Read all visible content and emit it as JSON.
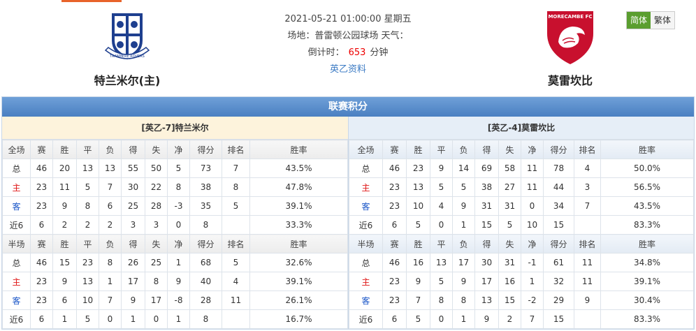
{
  "match": {
    "datetime": "2021-05-21 01:00:00 星期五",
    "venue_line": "场地：普雷顿公园球场 天气：",
    "countdown_label": "倒计时：",
    "countdown_value": "653",
    "countdown_unit": "分钟",
    "league_link": "英乙资料"
  },
  "home_team": {
    "name": "特兰米尔(主)",
    "logo_text": "TRANMERE ROVERS"
  },
  "away_team": {
    "name": "莫雷坎比",
    "logo_text": "MORECAMBE FC"
  },
  "language": {
    "simplified": "简体",
    "traditional": "繁体"
  },
  "standings": {
    "title": "联赛积分",
    "home": {
      "heading": "[英乙-7]特兰米尔",
      "full_header": [
        "全场",
        "赛",
        "胜",
        "平",
        "负",
        "得",
        "失",
        "净",
        "得分",
        "排名",
        "胜率"
      ],
      "full_rows": [
        [
          "总",
          "46",
          "20",
          "13",
          "13",
          "55",
          "50",
          "5",
          "73",
          "7",
          "43.5%"
        ],
        [
          "主",
          "23",
          "11",
          "5",
          "7",
          "30",
          "22",
          "8",
          "38",
          "8",
          "47.8%"
        ],
        [
          "客",
          "23",
          "9",
          "8",
          "6",
          "25",
          "28",
          "-3",
          "35",
          "5",
          "39.1%"
        ],
        [
          "近6",
          "6",
          "2",
          "2",
          "2",
          "3",
          "3",
          "0",
          "8",
          "",
          "33.3%"
        ]
      ],
      "half_header": [
        "半场",
        "赛",
        "胜",
        "平",
        "负",
        "得",
        "失",
        "净",
        "得分",
        "排名",
        "胜率"
      ],
      "half_rows": [
        [
          "总",
          "46",
          "15",
          "23",
          "8",
          "26",
          "25",
          "1",
          "68",
          "5",
          "32.6%"
        ],
        [
          "主",
          "23",
          "9",
          "13",
          "1",
          "17",
          "8",
          "9",
          "40",
          "4",
          "39.1%"
        ],
        [
          "客",
          "23",
          "6",
          "10",
          "7",
          "9",
          "17",
          "-8",
          "28",
          "11",
          "26.1%"
        ],
        [
          "近6",
          "6",
          "1",
          "5",
          "0",
          "1",
          "0",
          "1",
          "8",
          "",
          "16.7%"
        ]
      ]
    },
    "away": {
      "heading": "[英乙-4]莫雷坎比",
      "full_header": [
        "全场",
        "赛",
        "胜",
        "平",
        "负",
        "得",
        "失",
        "净",
        "得分",
        "排名",
        "胜率"
      ],
      "full_rows": [
        [
          "总",
          "46",
          "23",
          "9",
          "14",
          "69",
          "58",
          "11",
          "78",
          "4",
          "50.0%"
        ],
        [
          "主",
          "23",
          "13",
          "5",
          "5",
          "38",
          "27",
          "11",
          "44",
          "3",
          "56.5%"
        ],
        [
          "客",
          "23",
          "10",
          "4",
          "9",
          "31",
          "31",
          "0",
          "34",
          "7",
          "43.5%"
        ],
        [
          "近6",
          "6",
          "5",
          "0",
          "1",
          "15",
          "5",
          "10",
          "15",
          "",
          "83.3%"
        ]
      ],
      "half_header": [
        "半场",
        "赛",
        "胜",
        "平",
        "负",
        "得",
        "失",
        "净",
        "得分",
        "排名",
        "胜率"
      ],
      "half_rows": [
        [
          "总",
          "46",
          "16",
          "13",
          "17",
          "30",
          "31",
          "-1",
          "61",
          "11",
          "34.8%"
        ],
        [
          "主",
          "23",
          "9",
          "5",
          "9",
          "17",
          "16",
          "1",
          "32",
          "11",
          "39.1%"
        ],
        [
          "客",
          "23",
          "7",
          "8",
          "8",
          "13",
          "15",
          "-2",
          "29",
          "9",
          "30.4%"
        ],
        [
          "近6",
          "6",
          "5",
          "0",
          "1",
          "9",
          "2",
          "7",
          "15",
          "",
          "83.3%"
        ]
      ]
    }
  },
  "colors": {
    "home_row_label": "#e01818",
    "away_row_label": "#1a56c8",
    "accent": "#4a7fc1",
    "active_lang": "#5a9e2f"
  }
}
